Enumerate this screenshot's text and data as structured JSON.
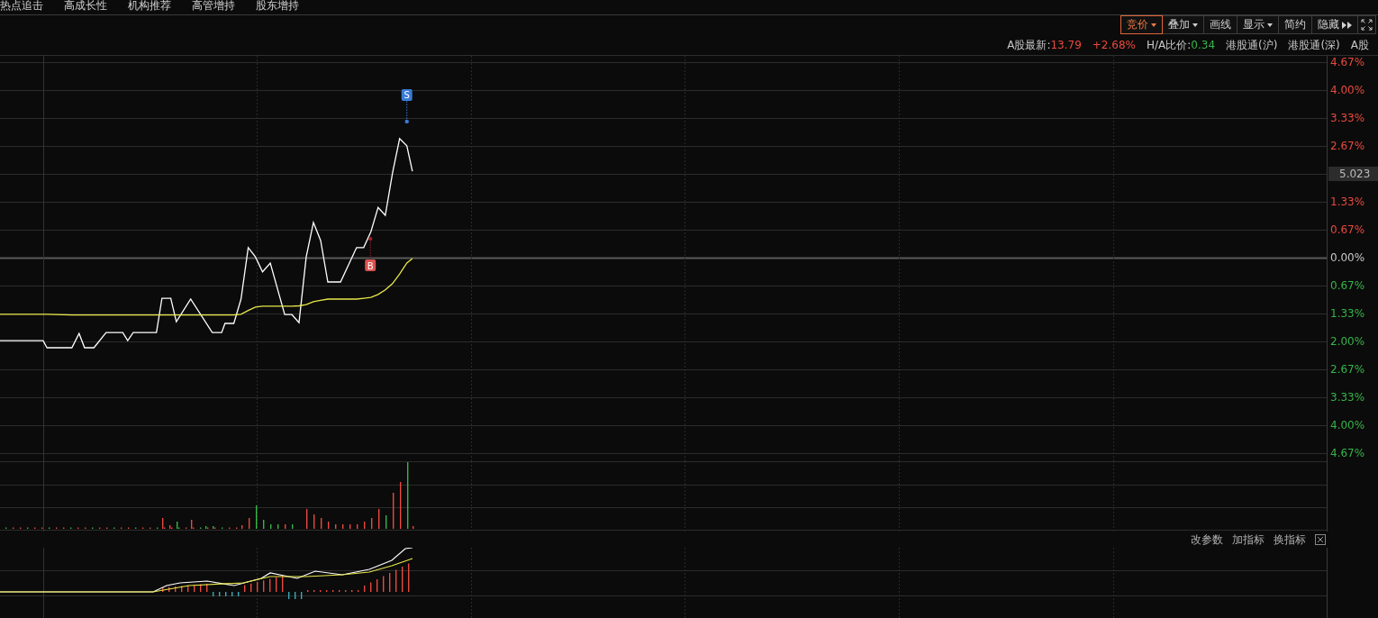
{
  "menu": [
    {
      "label": "热点追击"
    },
    {
      "label": "高成长性"
    },
    {
      "label": "机构推荐"
    },
    {
      "label": "高管增持"
    },
    {
      "label": "股东增持"
    }
  ],
  "toolbar": [
    {
      "label": "竞价",
      "selected": true,
      "has_menu": true,
      "kind": "button"
    },
    {
      "label": "叠加",
      "selected": false,
      "has_menu": true,
      "kind": "button"
    },
    {
      "label": "画线",
      "selected": false,
      "has_menu": false,
      "kind": "button"
    },
    {
      "label": "显示",
      "selected": false,
      "has_menu": true,
      "kind": "button"
    },
    {
      "label": "简约",
      "selected": false,
      "has_menu": false,
      "kind": "button"
    },
    {
      "label": "隐藏",
      "selected": false,
      "kind": "expand"
    },
    {
      "kind": "fullscreen"
    }
  ],
  "info": [
    {
      "label": "A股最新:",
      "value": "13.79",
      "color": "#e8493f"
    },
    {
      "value": "+2.68%",
      "color": "#e8493f"
    },
    {
      "label": "H/A比价:",
      "value": "0.34",
      "color": "#35b44a"
    },
    {
      "label": "港股通(沪)"
    },
    {
      "label": "港股通(深)"
    },
    {
      "label": "A股"
    }
  ],
  "markers": [
    {
      "kind": "sell",
      "label": "S"
    },
    {
      "kind": "buy",
      "label": "B"
    }
  ],
  "axis_labels": [
    {
      "kind": "tick",
      "label": "4.67%",
      "color": "#e8493f"
    },
    {
      "kind": "tick",
      "label": "4.00%",
      "color": "#e8493f"
    },
    {
      "kind": "tick",
      "label": "3.33%",
      "color": "#e8493f"
    },
    {
      "kind": "tick",
      "label": "2.67%",
      "color": "#e8493f"
    },
    {
      "kind": "readout",
      "label": "5.023"
    },
    {
      "kind": "tick",
      "label": "1.33%",
      "color": "#e8493f"
    },
    {
      "kind": "tick",
      "label": "0.67%",
      "color": "#e8493f"
    },
    {
      "kind": "tick",
      "label": "0.00%",
      "color": "#c8c8c8"
    },
    {
      "kind": "tick",
      "label": "0.67%",
      "color": "#35b44a"
    },
    {
      "kind": "tick",
      "label": "1.33%",
      "color": "#35b44a"
    },
    {
      "kind": "tick",
      "label": "2.00%",
      "color": "#35b44a"
    },
    {
      "kind": "tick",
      "label": "2.67%",
      "color": "#35b44a"
    },
    {
      "kind": "tick",
      "label": "3.33%",
      "color": "#35b44a"
    },
    {
      "kind": "tick",
      "label": "4.00%",
      "color": "#35b44a"
    },
    {
      "kind": "tick",
      "label": "4.67%",
      "color": "#35b44a"
    }
  ],
  "indicator_actions": [
    {
      "label": "改参数",
      "kind": "text"
    },
    {
      "label": "加指标",
      "kind": "text"
    },
    {
      "label": "换指标",
      "kind": "text"
    },
    {
      "kind": "close"
    }
  ]
}
